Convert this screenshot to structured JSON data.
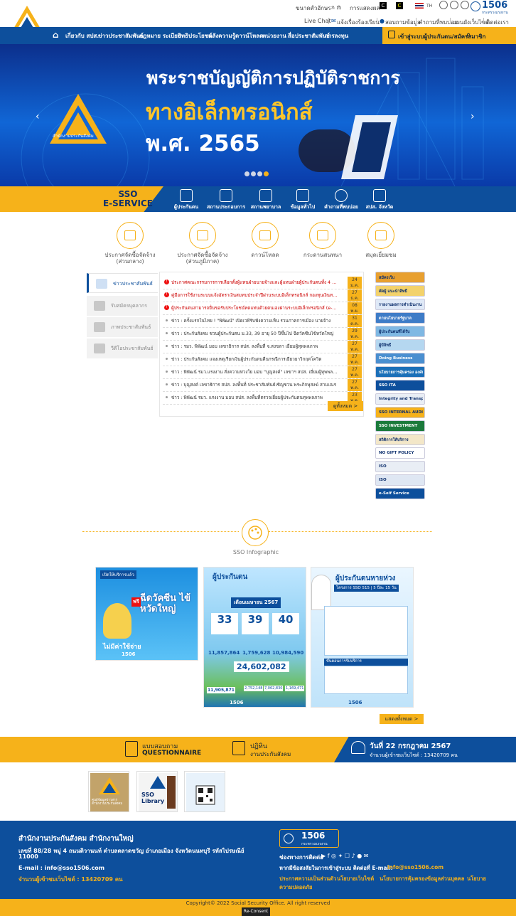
{
  "util": {
    "font_size_label": "ขนาดตัวอักษร",
    "font_a1": "ก",
    "font_a2": "ก",
    "display_label": "การแสดงผล",
    "contrast_c1": "C",
    "contrast_c2": "C",
    "lang": "TH",
    "hotline": "1506",
    "hotline_sub": "กระทรวงแรงงาน",
    "live_chat": "Live Chat",
    "complaint": "แจ้งเรื่องร้องเรียน",
    "ask": "สอบถามข้อมูล",
    "faq": "คำถามที่พบบ่อย",
    "sitemap": "แผนผังเว็บไซต์",
    "contact": "ติดต่อเรา"
  },
  "nav": {
    "items": [
      "เกี่ยวกับ สปส.",
      "ข่าวประชาสัมพันธ์",
      "กฎหมาย ระเบียบ",
      "สิทธิประโยชน์",
      "คลังความรู้",
      "ดาวน์โหลด",
      "หน่วยงาน",
      "สื่อประชาสัมพันธ์",
      "การลงทุน"
    ],
    "login": "เข้าสู่ระบบผู้ประกันตน/สมัครสมาชิก"
  },
  "banner": {
    "line1": "พระราชบัญญัติการปฏิบัติราชการ",
    "line2": "ทางอิเล็กทรอนิกส์",
    "line3": "พ.ศ. 2565",
    "org": "สำนักงานประกันสังคม"
  },
  "eservice": {
    "title1": "SSO",
    "title2": "E-SERVICE",
    "items": [
      "ผู้ประกันตน",
      "สถานประกอบการ",
      "สถานพยาบาล",
      "ข้อมูลทั่วไป",
      "คำถามที่พบบ่อย",
      "สปส. จังหวัด"
    ]
  },
  "quick": [
    {
      "l1": "ประกาศจัดซื้อจัดจ้าง",
      "l2": "(ส่วนกลาง)"
    },
    {
      "l1": "ประกาศจัดซื้อจัดจ้าง",
      "l2": "(ส่วนภูมิภาค)"
    },
    {
      "l1": "ดาวน์โหลด",
      "l2": ""
    },
    {
      "l1": "กระดานสนทนา",
      "l2": ""
    },
    {
      "l1": "สมุดเยี่ยมชม",
      "l2": ""
    }
  ],
  "tabs": [
    "ข่าวประชาสัมพันธ์",
    "รับสมัครบุคลากร",
    "ภาพประชาสัมพันธ์",
    "วีดีโอประชาสัมพันธ์"
  ],
  "news": [
    {
      "text": "ประกาศคณะกรรมการการเลือกตั้งผู้แทนฝ่ายนายจ้างและผู้แทนฝ่ายผู้ประกันตนทั้ง 4 ฉบับ",
      "d": "24",
      "m": "ม.ค.",
      "hot": true
    },
    {
      "text": "คู่มือการใช้งานระบบแจ้งอัตราเงินสมทบประจำปีผ่านระบบอิเล็กทรอนิกส์ กองทุนเงินทดแทน",
      "d": "27",
      "m": "ธ.ค.",
      "hot": true
    },
    {
      "text": "ผู้ประกันตนสามารถยื่นขอรับประโยชน์ทดแทนด้วยตนเองผ่านระบบอิเล็กทรอนิกส์ (e-Service)",
      "d": "08",
      "m": "พ.ย.",
      "hot": true
    },
    {
      "text": "ข่าว : ครั้งแรกในไทย ! \"พิพัฒน์\" เปิดเวทีรับฟังความเห็น รวมภาคการเมือง นายจ้าง",
      "d": "31",
      "m": "ต.ค.",
      "hot": false
    },
    {
      "text": "ข่าว : ประกันสังคม ชวนผู้ประกันตน ม.33, 39 อายุ 50 ปีขึ้นไป ฉีดวัคซีนไข้หวัดใหญ่",
      "d": "29",
      "m": "พ.ค.",
      "hot": false
    },
    {
      "text": "ข่าว : รมว. พิพัฒน์ มอบ เลขาธิการ สปส. ลงพื้นที่ จ.สงขลา เยี่ยมผู้ทุพพลภาพ",
      "d": "27",
      "m": "พ.ค.",
      "hot": false
    },
    {
      "text": "ข่าว : ประกันสังคม แจงเหตุเรียกเงินผู้ประกันตนคืนกรณีการเยียวยาวิกฤตโควิด",
      "d": "27",
      "m": "พ.ค.",
      "hot": false
    },
    {
      "text": "ข่าว : พิพัฒน์ รมว.แรงงาน สั่งความห่วงใย มอบ \"บุญสงค์\" เลขาฯ สปส. เยี่ยมผู้ทุพพลภาพ",
      "d": "27",
      "m": "พ.ค.",
      "hot": false
    },
    {
      "text": "ข่าว : บุญสงค์ เลขาธิการ สปส. ลงพื้นที่ ประชาสัมพันธ์เชิญชวน พระภิกษุสงฆ์ สามเณร",
      "d": "27",
      "m": "พ.ค.",
      "hot": false
    },
    {
      "text": "ข่าว : พิพัฒน์ รมว. แรงงาน มอบ สปส. ลงพื้นที่ตรวจเยี่ยมผู้ประกันตนทุพพลภาพ",
      "d": "23",
      "m": "พ.ค.",
      "hot": false
    }
  ],
  "see_all": "ดูทั้งหมด >",
  "side": [
    {
      "label": "สมัครเว็บ",
      "color": "#e8a030"
    },
    {
      "label": "คัดผู้ แนะนำสิทธิ์",
      "color": "#f3d26b"
    },
    {
      "label": "รายงานผลการดำเนินงาน",
      "color": "#dfe9f7"
    },
    {
      "label": "ตามนโยบายรัฐบาล",
      "color": "#3e7cc7"
    },
    {
      "label": "ผู้ประกันตนที่ได้รับ",
      "color": "#7fb8e3"
    },
    {
      "label": "ผู้มีสิทธิ์",
      "color": "#b5d7f0"
    },
    {
      "label": "Doing Business",
      "color": "#4a8fd0"
    },
    {
      "label": "นโยบายการคุ้มครอง องค์กรที่ดี",
      "color": "#1b6fb8"
    },
    {
      "label": "SSO ITA",
      "color": "#0d4f9c"
    },
    {
      "label": "Integrity and Transparency",
      "color": "#e9eef5"
    },
    {
      "label": "SSO INTERNAL AUDIT",
      "color": "#f6b21a"
    },
    {
      "label": "SSO INVESTMENT",
      "color": "#1b7a3b"
    },
    {
      "label": "สถิติการให้บริการ",
      "color": "#f3e7c8"
    },
    {
      "label": "NO GIFT POLICY",
      "color": "#ffffff"
    },
    {
      "label": "ISO",
      "color": "#e9eef5"
    },
    {
      "label": "ISO",
      "color": "#dfe7f3"
    },
    {
      "label": "e-Self Service",
      "color": "#0d4f9c"
    }
  ],
  "infographic": {
    "title": "SSO Infographic",
    "see_all": "แสดงทั้งหมด >"
  },
  "cards": [
    {
      "head": "เปิดให้บริการแล้ว",
      "big": "ฉีดวัคซีน ไข้หวัดใหญ่",
      "free": "ฟรี",
      "foot": "ไม่มีค่าใช้จ่าย"
    },
    {
      "head": "ผู้ประกันตน",
      "month": "เดือนเมษายน 2567",
      "s1": "33",
      "s2": "39",
      "s3": "40",
      "v1": "11,857,864",
      "v2": "1,759,628",
      "v3": "10,984,590",
      "total": "24,602,082",
      "m1": "11,905,871",
      "m2": "2,752,148",
      "m3": "7,062,830",
      "m4": "1,169,471"
    },
    {
      "head": "ผู้ประกันตนหายห่วง",
      "sub": "โครงการ SSO 515 | 5 ปีละ 15 วัน",
      "step": "ขั้นตอนการรับบริการ"
    }
  ],
  "card_hotline": "1506",
  "qbar": {
    "q1": "แบบสอบถาม",
    "q2": "QUESTIONNAIRE",
    "c1": "ปฏิทิน",
    "c2": "งานประกันสังคม",
    "date": "วันที่ 22 กรกฎาคม 2567",
    "visits": "จำนวนผู้เข้าชมเว็บไซต์ : 13420709 คน"
  },
  "links": [
    {
      "label": "ศูนย์ข้อมูลข่าวสาร สำนักงานประกันสังคม"
    },
    {
      "label": "SSO Library"
    },
    {
      "label": "QR"
    }
  ],
  "footer": {
    "title": "สำนักงานประกันสังคม สำนักงานใหญ่",
    "addr1": "เลขที่ 88/28 หมู่ 4 ถนนติวานนท์ ตำบลตลาดขวัญ อำเภอเมือง จังหวัดนนทบุรี รหัสไปรษณีย์",
    "addr2": "11000",
    "email": "E-mail : info@sso1506.com",
    "visits": "จำนวนผู้เข้าชมเว็บไซต์ : 13420709 คน",
    "hotline": "1506",
    "hotline_sub": "กระทรวงแรงงาน",
    "contact_ch": "ช่องทางการติดต่อ",
    "issue": "หากมีข้อสงสัยในการเข้าสู่ระบบ ติดต่อที่ E-mail:",
    "issue_mail": "info@sso1506.com",
    "policy1": "ประกาศความเป็นส่วนตัว",
    "policy2": "นโยบายเว็บไซต์",
    "policy3": "นโยบายการคุ้มครองข้อมูลส่วนบุคคล",
    "policy4": "นโยบาย",
    "policy5": "ความปลอดภัย"
  },
  "copyright": "Copyright© 2022 Social Security Office. All right reserved",
  "reconsent": "Re-Consent"
}
